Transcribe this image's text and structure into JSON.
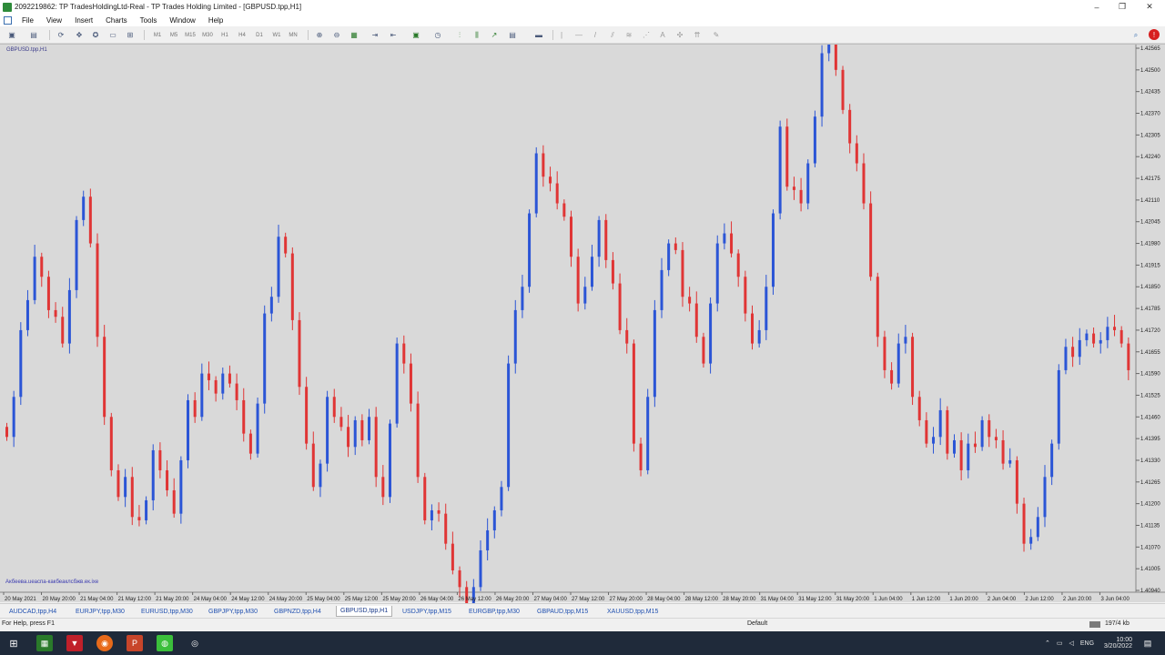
{
  "window": {
    "title": "2092219862: TP TradesHoldingLtd-Real - TP Trades Holding Limited - [GBPUSD.tpp,H1]",
    "controls": [
      "–",
      "❐",
      "✕"
    ]
  },
  "menu": [
    "File",
    "View",
    "Insert",
    "Charts",
    "Tools",
    "Window",
    "Help"
  ],
  "toolbar": {
    "timeframes": [
      "M1",
      "M5",
      "M15",
      "M30",
      "H1",
      "H4",
      "D1",
      "W1",
      "MN"
    ]
  },
  "chart": {
    "symbol_label": "GBPUSD.tpp,H1",
    "bg_color": "#d9d9d9",
    "up_color": "#2b55d6",
    "down_color": "#e03535",
    "watermark": "Акбеевa.ueacпа-какбеаклсбжв.ек.ixe"
  },
  "chart_data": {
    "type": "candlestick",
    "symbol": "GBPUSD.tpp",
    "timeframe": "H1",
    "y_ticks": [
      "1.42565",
      "1.42500",
      "1.42435",
      "1.42370",
      "1.42305",
      "1.42240",
      "1.42175",
      "1.42110",
      "1.42045",
      "1.41980",
      "1.41915",
      "1.41850",
      "1.41785",
      "1.41720",
      "1.41655",
      "1.41590",
      "1.41525",
      "1.41460",
      "1.41395",
      "1.41330",
      "1.41265",
      "1.41200",
      "1.41135",
      "1.41070",
      "1.41005",
      "1.40940"
    ],
    "x_ticks": [
      "20 May 2021",
      "20 May 20:00",
      "21 May 04:00",
      "21 May 12:00",
      "21 May 20:00",
      "24 May 04:00",
      "24 May 12:00",
      "24 May 20:00",
      "25 May 04:00",
      "25 May 12:00",
      "25 May 20:00",
      "26 May 04:00",
      "26 May 12:00",
      "26 May 20:00",
      "27 May 04:00",
      "27 May 12:00",
      "27 May 20:00",
      "28 May 04:00",
      "28 May 12:00",
      "28 May 20:00",
      "31 May 04:00",
      "31 May 12:00",
      "31 May 20:00",
      "1 Jun 04:00",
      "1 Jun 12:00",
      "1 Jun 20:00",
      "2 Jun 04:00",
      "2 Jun 12:00",
      "2 Jun 20:00",
      "3 Jun 04:00"
    ],
    "closes": [
      1.414,
      1.4152,
      1.4172,
      1.4181,
      1.4194,
      1.4188,
      1.4178,
      1.4176,
      1.4168,
      1.4184,
      1.4205,
      1.4212,
      1.4198,
      1.417,
      1.4146,
      1.413,
      1.4122,
      1.4128,
      1.4116,
      1.4115,
      1.4121,
      1.4136,
      1.413,
      1.4124,
      1.4117,
      1.4133,
      1.4151,
      1.4146,
      1.4159,
      1.4157,
      1.4153,
      1.4159,
      1.4156,
      1.4151,
      1.4141,
      1.4135,
      1.415,
      1.4177,
      1.4182,
      1.42,
      1.4195,
      1.4175,
      1.4155,
      1.4138,
      1.4125,
      1.4132,
      1.4152,
      1.4146,
      1.4143,
      1.4137,
      1.4145,
      1.4139,
      1.4146,
      1.4128,
      1.4122,
      1.4144,
      1.4168,
      1.4162,
      1.415,
      1.4128,
      1.4115,
      1.4118,
      1.4117,
      1.4108,
      1.41,
      1.4095,
      1.408,
      1.4095,
      1.4106,
      1.4112,
      1.4118,
      1.4125,
      1.4162,
      1.4178,
      1.4185,
      1.4207,
      1.4225,
      1.4218,
      1.4216,
      1.421,
      1.4206,
      1.4194,
      1.418,
      1.4185,
      1.4194,
      1.4205,
      1.4193,
      1.4186,
      1.4172,
      1.4168,
      1.4138,
      1.413,
      1.4152,
      1.4178,
      1.419,
      1.4198,
      1.4196,
      1.4182,
      1.418,
      1.417,
      1.4162,
      1.418,
      1.4198,
      1.4201,
      1.4195,
      1.4188,
      1.4177,
      1.4168,
      1.4172,
      1.4185,
      1.4207,
      1.4233,
      1.4215,
      1.4214,
      1.421,
      1.4222,
      1.4236,
      1.4255,
      1.4259,
      1.425,
      1.4238,
      1.4228,
      1.4222,
      1.421,
      1.4188,
      1.417,
      1.416,
      1.4156,
      1.4168,
      1.417,
      1.4152,
      1.4145,
      1.4138,
      1.414,
      1.4148,
      1.4135,
      1.4139,
      1.413,
      1.4138,
      1.4137,
      1.4145,
      1.414,
      1.4139,
      1.4132,
      1.4133,
      1.412,
      1.4108,
      1.411,
      1.4116,
      1.4128,
      1.4138,
      1.416,
      1.4167,
      1.4164,
      1.4169,
      1.4171,
      1.4168,
      1.4169,
      1.4173,
      1.4172,
      1.4168,
      1.416
    ]
  },
  "tabs": [
    {
      "label": "AUDCAD,tpp,H4",
      "active": false
    },
    {
      "label": "EURJPY,tpp,M30",
      "active": false
    },
    {
      "label": "EURUSD,tpp,M30",
      "active": false
    },
    {
      "label": "GBPJPY,tpp,M30",
      "active": false
    },
    {
      "label": "GBPNZD,tpp,H4",
      "active": false
    },
    {
      "label": "GBPUSD,tpp,H1",
      "active": true
    },
    {
      "label": "USDJPY,tpp,M15",
      "active": false
    },
    {
      "label": "EURGBP,tpp,M30",
      "active": false
    },
    {
      "label": "GBPAUD,tpp,M15",
      "active": false
    },
    {
      "label": "XAUUSD,tpp,M15",
      "active": false
    }
  ],
  "status": {
    "help": "For Help, press F1",
    "profile": "Default",
    "traffic": "197/4 kb"
  },
  "taskbar": {
    "lang": "ENG",
    "time": "10:00",
    "date": "3/20/2022"
  }
}
